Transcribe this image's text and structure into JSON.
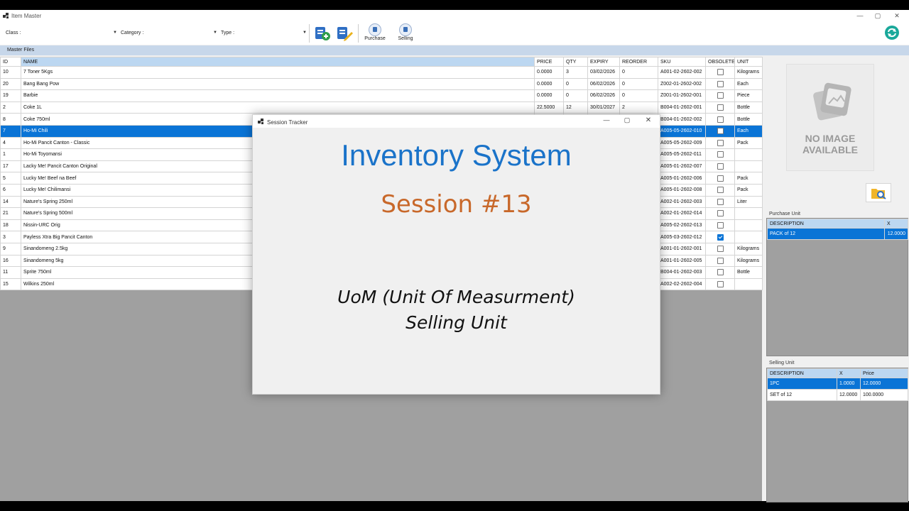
{
  "window": {
    "title": "Item Master"
  },
  "toolbar": {
    "class_label": "Class :",
    "category_label": "Category :",
    "type_label": "Type :",
    "purchase_label": "Purchase",
    "selling_label": "Selling"
  },
  "master_files_label": "Master Files",
  "grid": {
    "headers": [
      "ID",
      "NAME",
      "PRICE",
      "QTY",
      "EXPIRY",
      "REORDER",
      "SKU",
      "OBSOLETE",
      "UNIT"
    ],
    "rows": [
      {
        "id": "10",
        "name": "7 Toner 5Kgs",
        "price": "0.0000",
        "qty": "3",
        "expiry": "03/02/2026",
        "reorder": "0",
        "sku": "A001-02-2602-002",
        "obsolete": false,
        "unit": "Kilograms"
      },
      {
        "id": "20",
        "name": "Bang Bang Pow",
        "price": "0.0000",
        "qty": "0",
        "expiry": "06/02/2026",
        "reorder": "0",
        "sku": "Z002-01-2602-002",
        "obsolete": false,
        "unit": "Each"
      },
      {
        "id": "19",
        "name": "Barbie",
        "price": "0.0000",
        "qty": "0",
        "expiry": "06/02/2026",
        "reorder": "0",
        "sku": "Z001-01-2602-001",
        "obsolete": false,
        "unit": "Piece"
      },
      {
        "id": "2",
        "name": "Coke 1L",
        "price": "22.5000",
        "qty": "12",
        "expiry": "30/01/2027",
        "reorder": "2",
        "sku": "B004-01-2602-001",
        "obsolete": false,
        "unit": "Bottle"
      },
      {
        "id": "8",
        "name": "Coke 750ml",
        "price": "",
        "qty": "",
        "expiry": "",
        "reorder": "",
        "sku": "B004-01-2602-002",
        "obsolete": false,
        "unit": "Bottle"
      },
      {
        "id": "7",
        "name": "Ho-Mi Chili",
        "price": "",
        "qty": "",
        "expiry": "",
        "reorder": "",
        "sku": "A005-05-2602-010",
        "obsolete": false,
        "unit": "Each",
        "selected": true
      },
      {
        "id": "4",
        "name": "Ho-Mi Pancit Canton - Classic",
        "price": "",
        "qty": "",
        "expiry": "",
        "reorder": "",
        "sku": "A005-05-2602-009",
        "obsolete": false,
        "unit": "Pack"
      },
      {
        "id": "1",
        "name": "Ho-Mi Toyomansi",
        "price": "",
        "qty": "",
        "expiry": "",
        "reorder": "",
        "sku": "A005-05-2602-011",
        "obsolete": false,
        "unit": ""
      },
      {
        "id": "17",
        "name": "Lacky Me! Pancit Canton Original",
        "price": "",
        "qty": "",
        "expiry": "",
        "reorder": "",
        "sku": "A005-01-2602-007",
        "obsolete": false,
        "unit": ""
      },
      {
        "id": "5",
        "name": "Lucky Me! Beef na Beef",
        "price": "",
        "qty": "",
        "expiry": "",
        "reorder": "",
        "sku": "A005-01-2602-006",
        "obsolete": false,
        "unit": "Pack"
      },
      {
        "id": "6",
        "name": "Lucky Me! Chilimansi",
        "price": "",
        "qty": "",
        "expiry": "",
        "reorder": "",
        "sku": "A005-01-2602-008",
        "obsolete": false,
        "unit": "Pack"
      },
      {
        "id": "14",
        "name": "Nature's Spring 250ml",
        "price": "",
        "qty": "",
        "expiry": "",
        "reorder": "",
        "sku": "A002-01-2602-003",
        "obsolete": false,
        "unit": "Liter"
      },
      {
        "id": "21",
        "name": "Nature's Spring 500ml",
        "price": "",
        "qty": "",
        "expiry": "",
        "reorder": "",
        "sku": "A002-01-2602-014",
        "obsolete": false,
        "unit": ""
      },
      {
        "id": "18",
        "name": "Nissin-URC Orig",
        "price": "",
        "qty": "",
        "expiry": "",
        "reorder": "",
        "sku": "A005-02-2602-013",
        "obsolete": false,
        "unit": ""
      },
      {
        "id": "3",
        "name": "Payless Xtra Big Pancit Canton",
        "price": "",
        "qty": "",
        "expiry": "",
        "reorder": "",
        "sku": "A005-03-2602-012",
        "obsolete": true,
        "unit": ""
      },
      {
        "id": "9",
        "name": "Sinandomeng 2.5kg",
        "price": "",
        "qty": "",
        "expiry": "",
        "reorder": "",
        "sku": "A001-01-2602-001",
        "obsolete": false,
        "unit": "Kilograms"
      },
      {
        "id": "16",
        "name": "Sinandomeng 5kg",
        "price": "",
        "qty": "",
        "expiry": "",
        "reorder": "",
        "sku": "A001-01-2602-005",
        "obsolete": false,
        "unit": "Kilograms"
      },
      {
        "id": "11",
        "name": "Sprite 750ml",
        "price": "",
        "qty": "",
        "expiry": "",
        "reorder": "",
        "sku": "B004-01-2602-003",
        "obsolete": false,
        "unit": "Bottle"
      },
      {
        "id": "15",
        "name": "Wilkins 250ml",
        "price": "",
        "qty": "",
        "expiry": "",
        "reorder": "",
        "sku": "A002-02-2602-004",
        "obsolete": false,
        "unit": ""
      }
    ]
  },
  "image_panel": {
    "line1": "NO IMAGE",
    "line2": "AVAILABLE"
  },
  "purchase_unit": {
    "label": "Purchase Unit",
    "headers": [
      "DESCRIPTION",
      "X"
    ],
    "rows": [
      {
        "description": "PACK of 12",
        "x": "12.0000",
        "selected": true
      }
    ]
  },
  "selling_unit": {
    "label": "Selling Unit",
    "headers": [
      "DESCRIPTION",
      "X",
      "Price"
    ],
    "rows": [
      {
        "description": "1PC",
        "x": "1.0000",
        "price": "12.0000",
        "selected": true
      },
      {
        "description": "SET of 12",
        "x": "12.0000",
        "price": "100.0000",
        "selected": false
      }
    ]
  },
  "dialog": {
    "title": "Session Tracker",
    "heading": "Inventory System",
    "session": "Session #13",
    "line1": "UoM (Unit Of Measurment)",
    "line2": "Selling Unit"
  },
  "colors": {
    "accent": "#0a74d6",
    "header_blue": "#bcd7f1",
    "heading_blue": "#1a73c9",
    "session_orange": "#c8682a"
  }
}
